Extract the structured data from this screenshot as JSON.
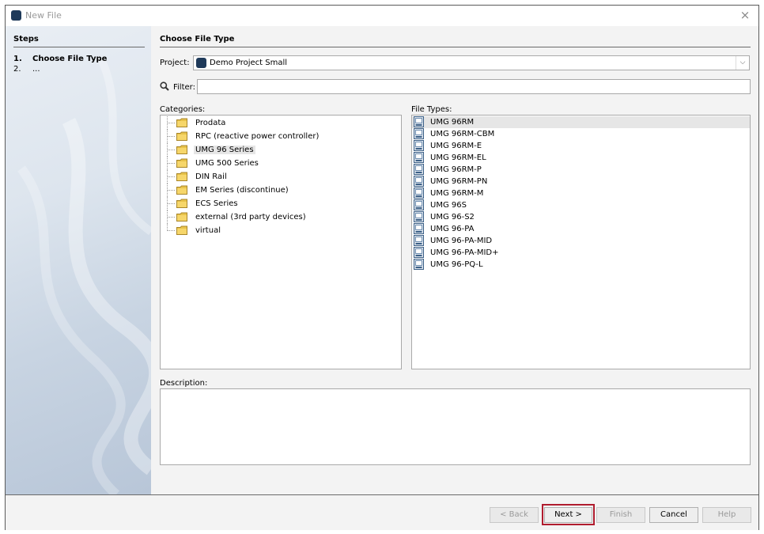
{
  "window": {
    "title": "New File",
    "close_glyph": "×"
  },
  "steps": {
    "title": "Steps",
    "items": [
      {
        "num": "1.",
        "label": "Choose File Type"
      },
      {
        "num": "2.",
        "label": "..."
      }
    ]
  },
  "main": {
    "title": "Choose File Type",
    "project": {
      "label": "Project:",
      "value": "Demo Project Small",
      "dropdown_glyph": "⌵"
    },
    "filter": {
      "label": "Filter:",
      "value": ""
    },
    "categories": {
      "label": "Categories:",
      "items": [
        {
          "label": "Prodata"
        },
        {
          "label": "RPC (reactive power controller)"
        },
        {
          "label": "UMG 96 Series",
          "selected": true
        },
        {
          "label": "UMG 500 Series"
        },
        {
          "label": "DIN Rail"
        },
        {
          "label": "EM Series (discontinue)"
        },
        {
          "label": "ECS Series"
        },
        {
          "label": "external (3rd party devices)"
        },
        {
          "label": "virtual"
        }
      ]
    },
    "file_types": {
      "label": "File Types:",
      "items": [
        {
          "label": "UMG 96RM",
          "selected": true
        },
        {
          "label": "UMG 96RM-CBM"
        },
        {
          "label": "UMG 96RM-E"
        },
        {
          "label": "UMG 96RM-EL"
        },
        {
          "label": "UMG 96RM-P"
        },
        {
          "label": "UMG 96RM-PN"
        },
        {
          "label": "UMG 96RM-M"
        },
        {
          "label": "UMG 96S"
        },
        {
          "label": "UMG 96-S2"
        },
        {
          "label": "UMG 96-PA"
        },
        {
          "label": "UMG 96-PA-MID"
        },
        {
          "label": "UMG 96-PA-MID+"
        },
        {
          "label": "UMG 96-PQ-L"
        }
      ]
    },
    "description": {
      "label": "Description:",
      "value": ""
    }
  },
  "footer": {
    "back": "< Back",
    "next": "Next >",
    "finish": "Finish",
    "cancel": "Cancel",
    "help": "Help"
  },
  "colors": {
    "highlight": "#b01c2e",
    "selection": "#e6e6e6",
    "project_icon": "#1f3a5a"
  }
}
